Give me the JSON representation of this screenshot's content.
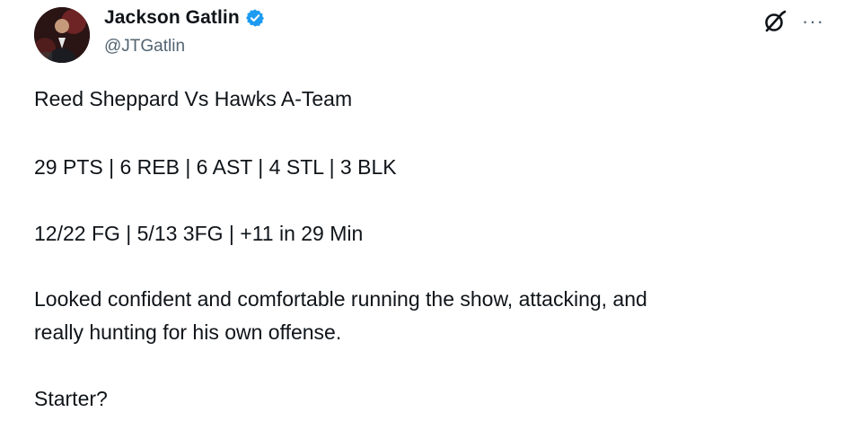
{
  "author": {
    "display_name": "Jackson Gatlin",
    "handle": "@JTGatlin",
    "verified": true,
    "avatar_icon": "profile-photo",
    "verified_color": "#1d9bf0"
  },
  "actions": {
    "grok_icon": "grok-icon",
    "more_icon": "more-options-icon",
    "more_label": "···"
  },
  "tweet": {
    "line1": "Reed Sheppard Vs Hawks A-Team",
    "line2": "29 PTS | 6 REB | 6 AST | 4 STL | 3 BLK",
    "line3": "12/22 FG | 5/13 3FG | +11 in 29 Min",
    "line4": "Looked confident and comfortable running the show, attacking, and\nreally hunting for his own offense.",
    "line5": "Starter?"
  }
}
